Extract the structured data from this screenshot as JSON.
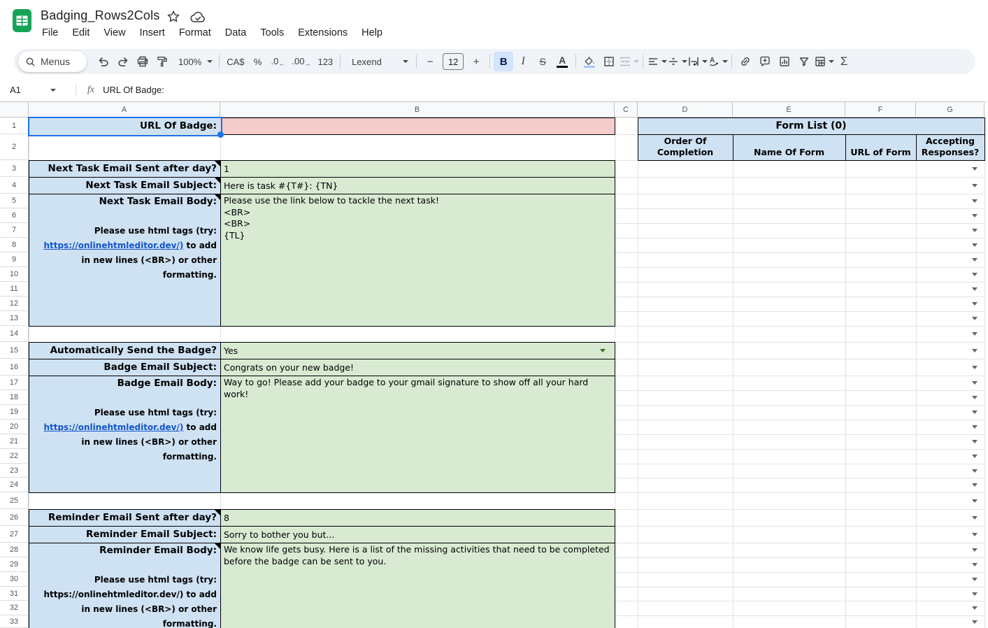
{
  "app": {
    "title": "Badging_Rows2Cols"
  },
  "menubar": {
    "items": [
      "File",
      "Edit",
      "View",
      "Insert",
      "Format",
      "Data",
      "Tools",
      "Extensions",
      "Help"
    ]
  },
  "toolbar": {
    "search_label": "Menus",
    "zoom_level": "100%",
    "currency_format": "CA$",
    "percent_format": "%",
    "decrease_decimal": ".0",
    "increase_decimal": ".00",
    "more_formats": "123",
    "font_name": "Lexend",
    "font_size": "12",
    "decrease_font": "−",
    "increase_font": "+",
    "bold": "B",
    "italic": "I",
    "strikethrough": "S",
    "text_color": "A",
    "functions": "Σ",
    "icons": [
      "search-icon",
      "undo-icon",
      "redo-icon",
      "print-icon",
      "paint-format-icon",
      "fill-color-icon",
      "borders-icon",
      "merge-cells-icon",
      "horizontal-align-icon",
      "vertical-align-icon",
      "text-wrap-icon",
      "text-rotation-icon",
      "insert-link-icon",
      "insert-comment-icon",
      "insert-chart-icon",
      "create-filter-icon",
      "table-views-icon"
    ]
  },
  "formula_bar": {
    "cell_ref": "A1",
    "fx_label": "fx",
    "value": "URL Of Badge:"
  },
  "grid": {
    "col_headers": [
      "A",
      "B",
      "C",
      "D",
      "E",
      "F",
      "G"
    ],
    "rows_visible": 33,
    "cells": {
      "a1": "URL Of Badge:",
      "b1": "",
      "a3": "Next Task Email Sent after day?",
      "b3": "1",
      "a4": "Next Task Email Subject:",
      "b4": "Here is task #{T#}: {TN}",
      "a5_title": "Next Task Email Body:",
      "hint_line1": "Please use html tags (try:",
      "hint_link": "https://onlinehtmleditor.dev/)",
      "hint_after_link": " to add",
      "hint_line3": "in new lines (<BR>) or other",
      "hint_line4": "formatting.",
      "b5_line1": "Please use the link below to tackle the next task!",
      "b5_line2": "<BR>",
      "b5_line3": "<BR>",
      "b5_line4": "{TL}",
      "a15": "Automatically Send the Badge?",
      "b15": "Yes",
      "a16": "Badge Email Subject:",
      "b16": "Congrats on your new badge!",
      "a17_title": "Badge Email Body:",
      "b17": "Way to go! Please add your badge to your gmail signature to show off all your hard work!",
      "a26": "Reminder Email Sent after day?",
      "b26": "8",
      "a27": "Reminder Email Subject:",
      "b27": "Sorry to bother you but...",
      "a28_title": "Reminder Email Body:",
      "b28": "We know life gets busy. Here is a list of the missing activities that need to be completed before the badge can be sent to you."
    },
    "form_list": {
      "title": "Form List (0)",
      "headers": [
        "Order Of Completion",
        "Name Of Form",
        "URL of Form",
        "Accepting Responses?"
      ]
    }
  },
  "colors": {
    "label_blue": "#cfe2f3",
    "value_green": "#d9ead3",
    "input_pink": "#f4cccc",
    "link_blue": "#1155cc",
    "selection_blue": "#1a73e8",
    "toolbar_bg": "#f0f4f9",
    "active_toggle_bg": "#d2e3fc",
    "logo_green": "#17a356"
  }
}
